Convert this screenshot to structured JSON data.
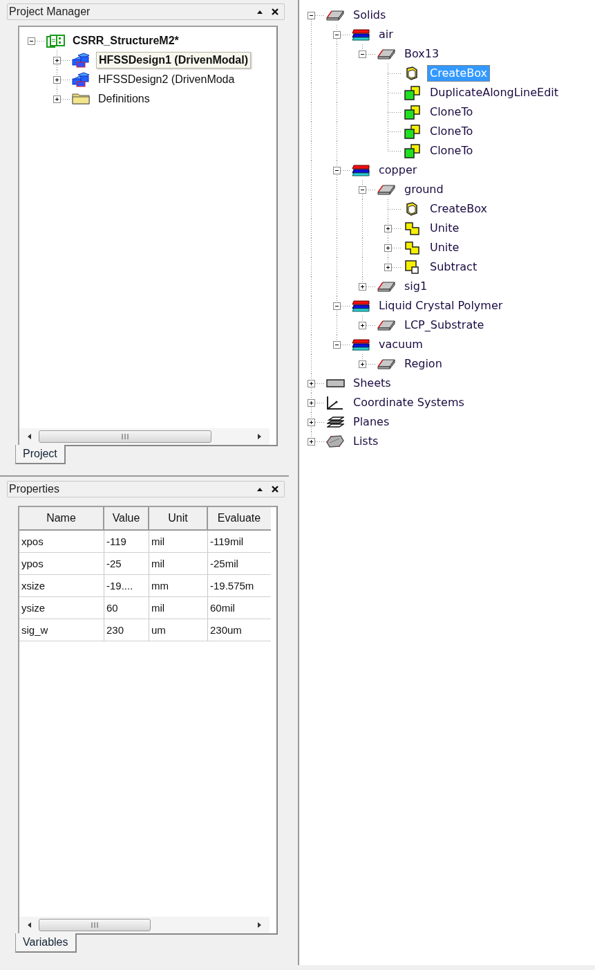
{
  "project_manager": {
    "title": "Project Manager",
    "tree": [
      {
        "label": "CSRR_StructureM2*",
        "kind": "project",
        "active": true,
        "expanded": true,
        "children": [
          {
            "label": "HFSSDesign1 (DrivenModal)",
            "kind": "design",
            "active": true,
            "tooltip": true,
            "expanded": false
          },
          {
            "label": "HFSSDesign2 (DrivenModa",
            "kind": "design",
            "active": false,
            "expanded": false
          },
          {
            "label": "Definitions",
            "kind": "folder",
            "active": false,
            "expanded": false
          }
        ]
      }
    ],
    "tabs": [
      {
        "label": "Project",
        "selected": true
      }
    ]
  },
  "properties": {
    "title": "Properties",
    "columns": [
      "Name",
      "Value",
      "Unit",
      "Evaluate"
    ],
    "rows": [
      [
        "xpos",
        "-119",
        "mil",
        "-119mil"
      ],
      [
        "ypos",
        "-25",
        "mil",
        "-25mil"
      ],
      [
        "xsize",
        "-19....",
        "mm",
        "-19.575m"
      ],
      [
        "ysize",
        "60",
        "mil",
        "60mil"
      ],
      [
        "sig_w",
        "230",
        "um",
        "230um"
      ]
    ],
    "tabs": [
      {
        "label": "Variables",
        "selected": true
      }
    ]
  },
  "model_tree": [
    {
      "label": "Solids",
      "kind": "solid",
      "selected": false,
      "expanded": true,
      "children": [
        {
          "label": "air",
          "kind": "material",
          "selected": false,
          "expanded": true,
          "children": [
            {
              "label": "Box13",
              "kind": "solid",
              "selected": false,
              "expanded": true,
              "children": [
                {
                  "label": "CreateBox",
                  "kind": "createbox",
                  "selected": true
                },
                {
                  "label": "DuplicateAlongLineEdit",
                  "kind": "clone",
                  "selected": false
                },
                {
                  "label": "CloneTo",
                  "kind": "clone",
                  "selected": false
                },
                {
                  "label": "CloneTo",
                  "kind": "clone",
                  "selected": false
                },
                {
                  "label": "CloneTo",
                  "kind": "clone",
                  "selected": false
                }
              ]
            }
          ]
        },
        {
          "label": "copper",
          "kind": "material",
          "selected": false,
          "expanded": true,
          "children": [
            {
              "label": "ground",
              "kind": "solid",
              "selected": false,
              "expanded": true,
              "children": [
                {
                  "label": "CreateBox",
                  "kind": "createbox",
                  "selected": false
                },
                {
                  "label": "Unite",
                  "kind": "unite",
                  "selected": false,
                  "expanded": false
                },
                {
                  "label": "Unite",
                  "kind": "unite",
                  "selected": false,
                  "expanded": false
                },
                {
                  "label": "Subtract",
                  "kind": "subtract",
                  "selected": false,
                  "expanded": false
                }
              ]
            },
            {
              "label": "sig1",
              "kind": "solid",
              "selected": false,
              "expanded": false
            }
          ]
        },
        {
          "label": "Liquid Crystal Polymer",
          "kind": "material",
          "selected": false,
          "expanded": true,
          "children": [
            {
              "label": "LCP_Substrate",
              "kind": "solid",
              "selected": false,
              "expanded": false
            }
          ]
        },
        {
          "label": "vacuum",
          "kind": "material",
          "selected": false,
          "expanded": true,
          "children": [
            {
              "label": "Region",
              "kind": "solid",
              "selected": false,
              "expanded": false
            }
          ]
        }
      ]
    },
    {
      "label": "Sheets",
      "kind": "sheet",
      "selected": false,
      "expanded": false
    },
    {
      "label": "Coordinate Systems",
      "kind": "coords",
      "selected": false,
      "expanded": false
    },
    {
      "label": "Planes",
      "kind": "planes",
      "selected": false,
      "expanded": false
    },
    {
      "label": "Lists",
      "kind": "list",
      "selected": false,
      "expanded": false
    }
  ]
}
